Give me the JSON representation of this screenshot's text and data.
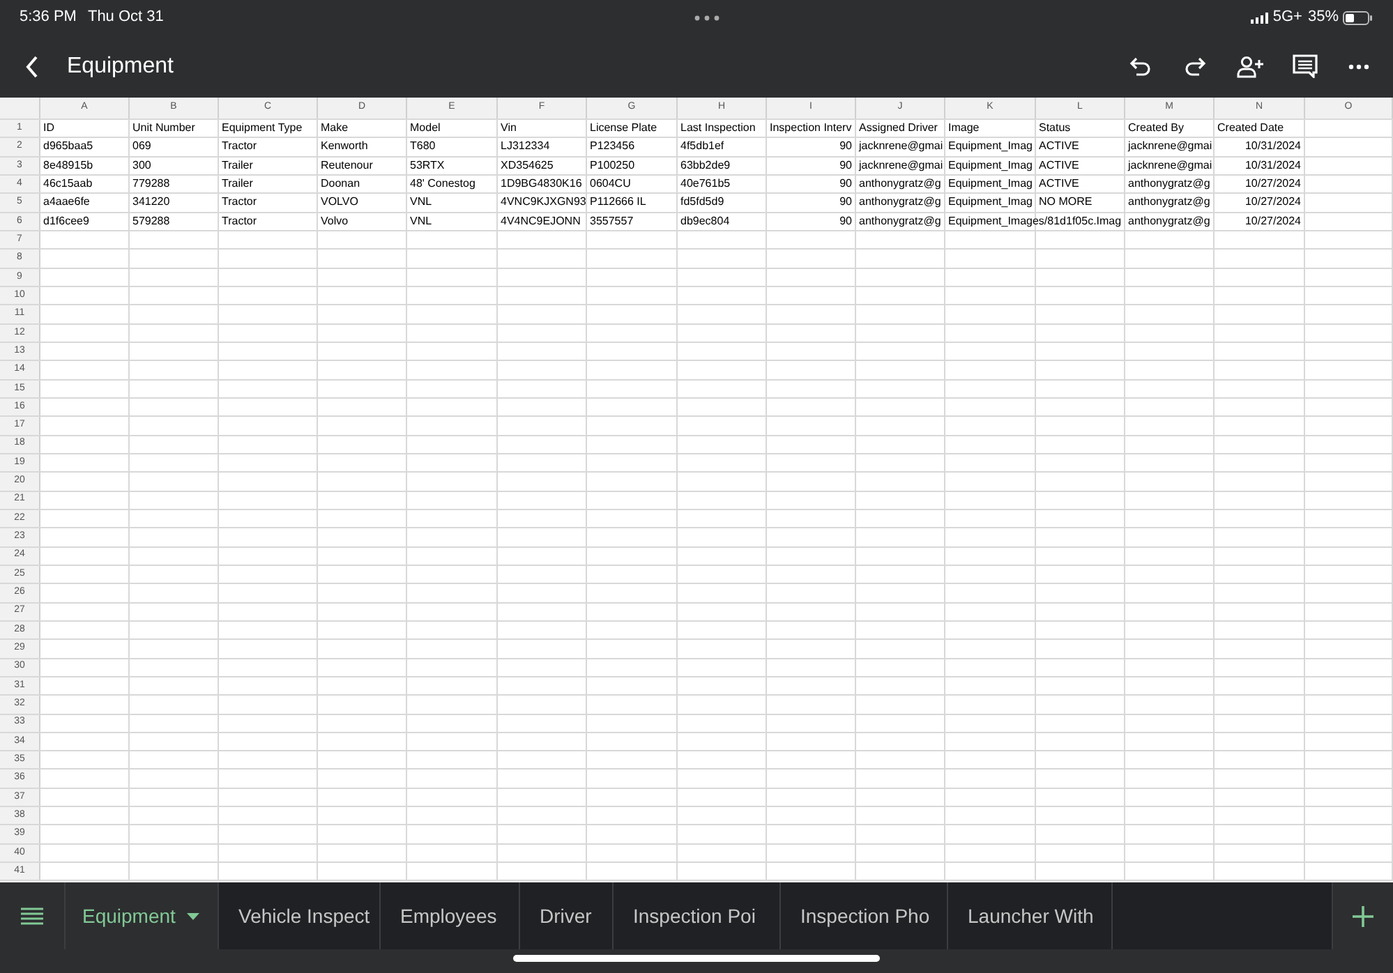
{
  "status_bar": {
    "time": "5:36 PM",
    "date": "Thu Oct 31",
    "network": "5G+",
    "battery": "35%"
  },
  "toolbar": {
    "title": "Equipment"
  },
  "sheet": {
    "column_letters": [
      "A",
      "B",
      "C",
      "D",
      "E",
      "F",
      "G",
      "H",
      "I",
      "J",
      "K",
      "L",
      "M",
      "N",
      "O"
    ],
    "row_numbers": [
      "1",
      "2",
      "3",
      "4",
      "5",
      "6",
      "7",
      "8",
      "9",
      "10",
      "11",
      "12",
      "13",
      "14",
      "15",
      "16",
      "17",
      "18",
      "19",
      "20",
      "21",
      "22",
      "23",
      "24",
      "25",
      "26",
      "27",
      "28",
      "29",
      "30",
      "31",
      "32",
      "33",
      "34",
      "35",
      "36",
      "37",
      "38",
      "39",
      "40",
      "41"
    ],
    "rows": [
      {
        "cells": [
          {
            "text": "ID"
          },
          {
            "text": "Unit Number"
          },
          {
            "text": "Equipment Type"
          },
          {
            "text": "Make"
          },
          {
            "text": "Model"
          },
          {
            "text": "Vin"
          },
          {
            "text": "License Plate"
          },
          {
            "text": "Last Inspection"
          },
          {
            "text": "Inspection Interv"
          },
          {
            "text": "Assigned Driver"
          },
          {
            "text": "Image"
          },
          {
            "text": "Status"
          },
          {
            "text": "Created By"
          },
          {
            "text": "Created Date"
          }
        ]
      },
      {
        "cells": [
          {
            "text": "d965baa5"
          },
          {
            "text": "069"
          },
          {
            "text": "Tractor"
          },
          {
            "text": "Kenworth"
          },
          {
            "text": "T680"
          },
          {
            "text": "LJ312334"
          },
          {
            "text": "P123456"
          },
          {
            "text": "4f5db1ef"
          },
          {
            "text": "90",
            "kind": "number"
          },
          {
            "text": "jacknrene@gmai"
          },
          {
            "text": "Equipment_Imag"
          },
          {
            "text": "ACTIVE"
          },
          {
            "text": "jacknrene@gmai"
          },
          {
            "text": "10/31/2024",
            "kind": "number"
          }
        ]
      },
      {
        "cells": [
          {
            "text": "8e48915b"
          },
          {
            "text": "300"
          },
          {
            "text": "Trailer"
          },
          {
            "text": "Reutenour"
          },
          {
            "text": "53RTX"
          },
          {
            "text": "XD354625"
          },
          {
            "text": "P100250"
          },
          {
            "text": "63bb2de9"
          },
          {
            "text": "90",
            "kind": "number"
          },
          {
            "text": "jacknrene@gmai"
          },
          {
            "text": "Equipment_Imag"
          },
          {
            "text": "ACTIVE"
          },
          {
            "text": "jacknrene@gmai"
          },
          {
            "text": "10/31/2024",
            "kind": "number"
          }
        ]
      },
      {
        "cells": [
          {
            "text": "46c15aab"
          },
          {
            "text": "779288"
          },
          {
            "text": "Trailer"
          },
          {
            "text": "Doonan"
          },
          {
            "text": "48' Conestog"
          },
          {
            "text": "1D9BG4830K16"
          },
          {
            "text": "0604CU"
          },
          {
            "text": "40e761b5"
          },
          {
            "text": "90",
            "kind": "number"
          },
          {
            "text": "anthonygratz@g"
          },
          {
            "text": "Equipment_Imag"
          },
          {
            "text": "ACTIVE"
          },
          {
            "text": "anthonygratz@g"
          },
          {
            "text": "10/27/2024",
            "kind": "number"
          }
        ]
      },
      {
        "cells": [
          {
            "text": "a4aae6fe"
          },
          {
            "text": "341220"
          },
          {
            "text": "Tractor"
          },
          {
            "text": "VOLVO"
          },
          {
            "text": "VNL"
          },
          {
            "text": "4VNC9KJXGN93"
          },
          {
            "text": "P112666 IL"
          },
          {
            "text": "fd5fd5d9"
          },
          {
            "text": "90",
            "kind": "number"
          },
          {
            "text": "anthonygratz@g"
          },
          {
            "text": "Equipment_Imag"
          },
          {
            "text": "NO MORE"
          },
          {
            "text": "anthonygratz@g"
          },
          {
            "text": "10/27/2024",
            "kind": "number"
          }
        ]
      },
      {
        "cells": [
          {
            "text": "d1f6cee9"
          },
          {
            "text": "579288"
          },
          {
            "text": "Tractor"
          },
          {
            "text": "Volvo"
          },
          {
            "text": "VNL"
          },
          {
            "text": "4V4NC9EJONN"
          },
          {
            "text": "3557557"
          },
          {
            "text": "db9ec804"
          },
          {
            "text": "90",
            "kind": "number"
          },
          {
            "text": "anthonygratz@g"
          },
          {
            "text": "Equipment_Images/81d1f05c.Imag"
          },
          {
            "text": ""
          },
          {
            "text": "anthonygratz@g"
          },
          {
            "text": "10/27/2024",
            "kind": "number"
          }
        ]
      }
    ]
  },
  "sheet_tabs": [
    {
      "label": "Equipment",
      "selected": true
    },
    {
      "label": "Vehicle Inspect",
      "selected": false
    },
    {
      "label": "Employees",
      "selected": false
    },
    {
      "label": "Driver",
      "selected": false
    },
    {
      "label": "Inspection Poi",
      "selected": false
    },
    {
      "label": "Inspection Pho",
      "selected": false
    },
    {
      "label": "Launcher With",
      "selected": false
    }
  ]
}
